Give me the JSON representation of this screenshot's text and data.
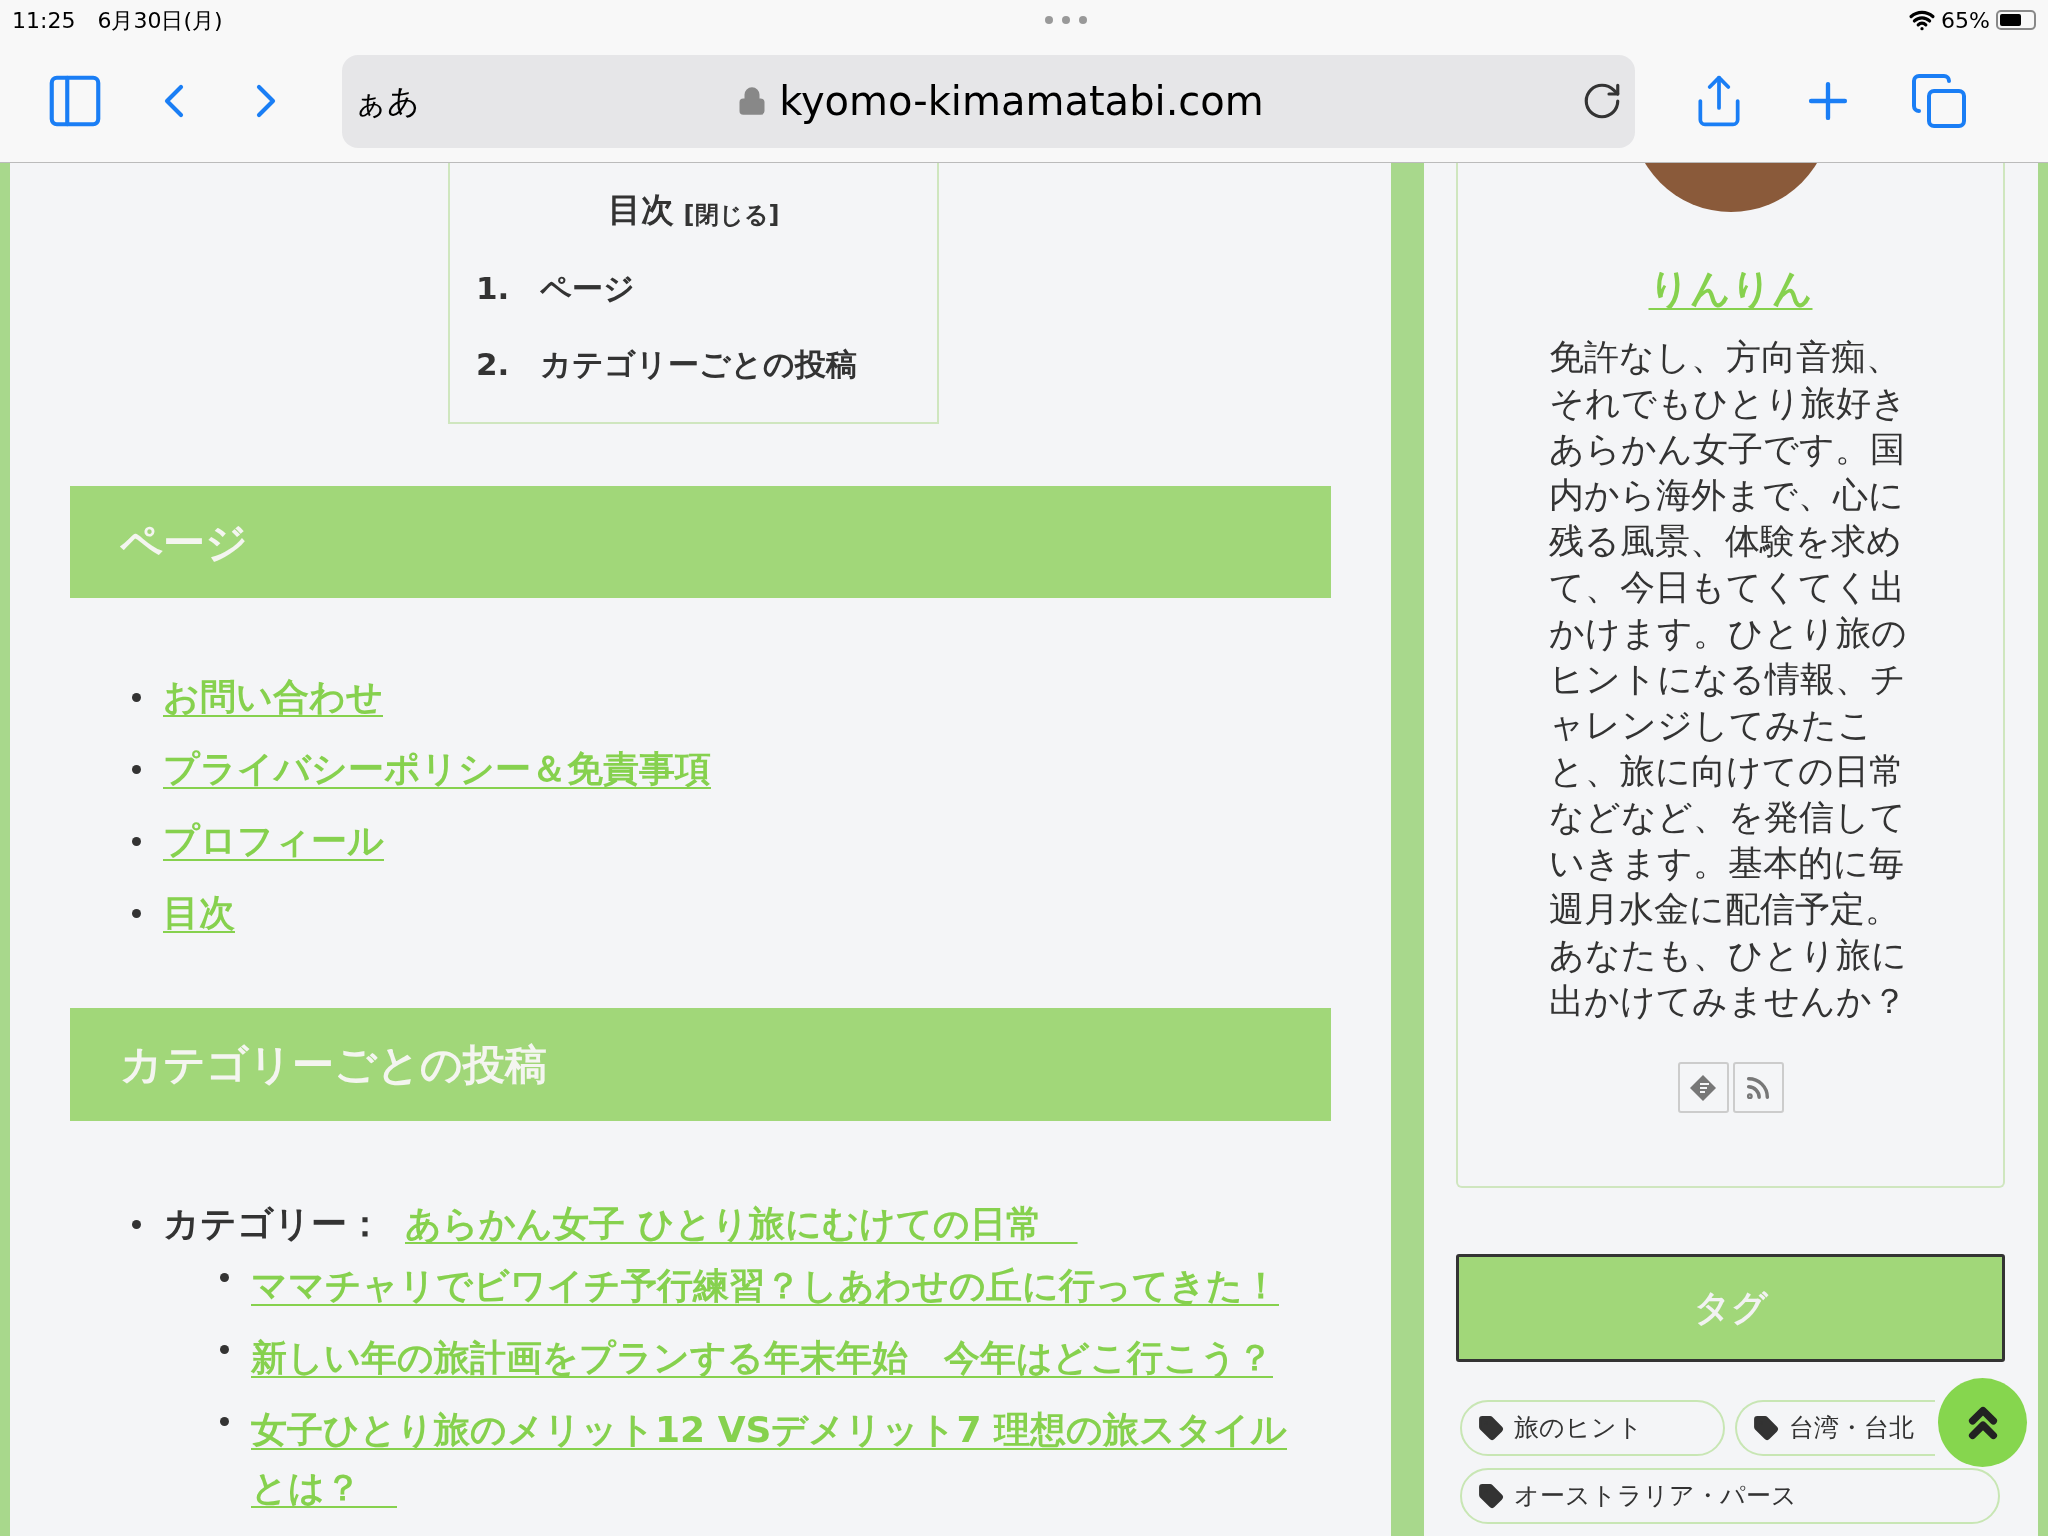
{
  "status_bar": {
    "time": "11:25",
    "date": "6月30日(月)",
    "battery": "65%"
  },
  "browser": {
    "text_size_button": "ぁあ",
    "url": "kyomo-kimamatabi.com"
  },
  "toc": {
    "title": "目次",
    "toggle": "[閉じる]",
    "items": [
      {
        "number": "1.",
        "label": "ページ"
      },
      {
        "number": "2.",
        "label": "カテゴリーごとの投稿"
      }
    ]
  },
  "pages_section": {
    "heading": "ページ",
    "links": [
      "お問い合わせ",
      "プライバシーポリシー＆免責事項",
      "プロフィール",
      "目次"
    ]
  },
  "category_section": {
    "heading": "カテゴリーごとの投稿",
    "categories": [
      {
        "label": "カテゴリー：",
        "link": "あらかん女子 ひとり旅にむけての日常　",
        "posts": [
          "ママチャリでビワイチ予行練習？しあわせの丘に行ってきた！",
          "新しい年の旅計画をプランする年末年始　今年はどこ行こう？",
          "女子ひとり旅のメリット12 VSデメリット7 理想の旅スタイルとは？　"
        ]
      }
    ]
  },
  "sidebar": {
    "profile": {
      "name": "りんりん",
      "bio": "免許なし、方向音痴、それでもひとり旅好きあらかん女子です。国内から海外まで、心に残る風景、体験を求めて、今日もてくてく出かけます。ひとり旅のヒントになる情報、チャレンジしてみたこと、旅に向けての日常などなど、を発信していきます。基本的に毎週月水金に配信予定。あなたも、ひとり旅に出かけてみませんか？"
    },
    "tags_heading": "タグ",
    "tags": [
      "旅のヒント",
      "台湾・台北",
      "オーストラリア・パース"
    ]
  }
}
